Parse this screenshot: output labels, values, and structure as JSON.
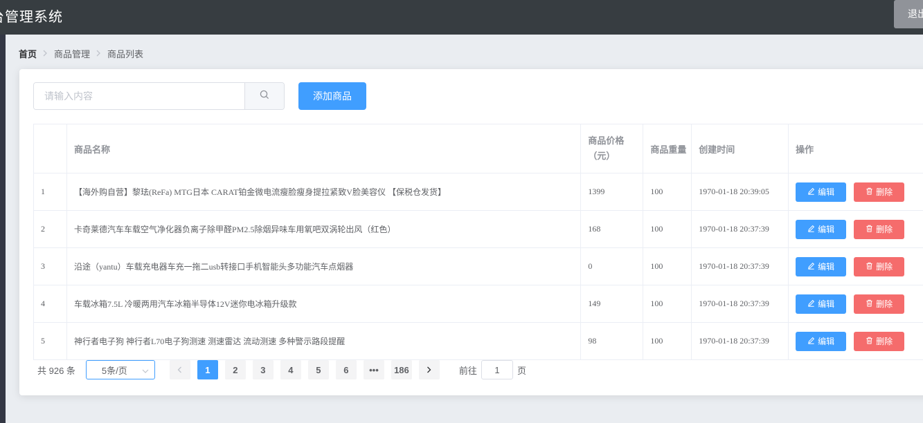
{
  "header": {
    "title": "台管理系统",
    "logout_label": "退出"
  },
  "breadcrumb": {
    "items": [
      "首页",
      "商品管理",
      "商品列表"
    ]
  },
  "search": {
    "placeholder": "请输入内容",
    "value": ""
  },
  "toolbar": {
    "add_label": "添加商品"
  },
  "table": {
    "columns": {
      "index": "",
      "name": "商品名称",
      "price_line1": "商品价格",
      "price_line2": "（元）",
      "weight": "商品重量",
      "created": "创建时间",
      "ops": "操作"
    },
    "rows": [
      {
        "index": "1",
        "name": "【海外购自营】黎珐(ReFa) MTG日本 CARAT铂金微电流瘦脸瘦身提拉紧致V脸美容仪 【保税仓发货】",
        "price": "1399",
        "weight": "100",
        "created": "1970-01-18 20:39:05"
      },
      {
        "index": "2",
        "name": "卡奇莱德汽车车载空气净化器负离子除甲醛PM2.5除烟异味车用氧吧双涡轮出风（红色）",
        "price": "168",
        "weight": "100",
        "created": "1970-01-18 20:37:39"
      },
      {
        "index": "3",
        "name": "沿途（yantu）车载充电器车充一拖二usb转接口手机智能头多功能汽车点烟器",
        "price": "0",
        "weight": "100",
        "created": "1970-01-18 20:37:39"
      },
      {
        "index": "4",
        "name": "车载冰箱7.5L 冷暖两用汽车冰箱半导体12V迷你电冰箱升级款",
        "price": "149",
        "weight": "100",
        "created": "1970-01-18 20:37:39"
      },
      {
        "index": "5",
        "name": "神行者电子狗 神行者L70电子狗测速 测速雷达 流动测速 多种警示路段提醒",
        "price": "98",
        "weight": "100",
        "created": "1970-01-18 20:37:39"
      }
    ],
    "edit_label": "编辑",
    "delete_label": "删除"
  },
  "pagination": {
    "total_text": "共 926 条",
    "page_size": "5条/页",
    "pages": [
      "1",
      "2",
      "3",
      "4",
      "5",
      "6",
      "•••",
      "186"
    ],
    "current_page": "1",
    "goto_prefix": "前往",
    "goto_value": "1",
    "goto_suffix": "页"
  },
  "colors": {
    "primary": "#409eff",
    "danger": "#f56c6c",
    "header_bg": "#373d41"
  },
  "icons": {
    "search": "search-icon",
    "edit": "edit-icon",
    "delete": "delete-icon",
    "prev": "chevron-left-icon",
    "next": "chevron-right-icon",
    "select": "chevron-down-icon",
    "separator": "chevron-right-icon"
  }
}
